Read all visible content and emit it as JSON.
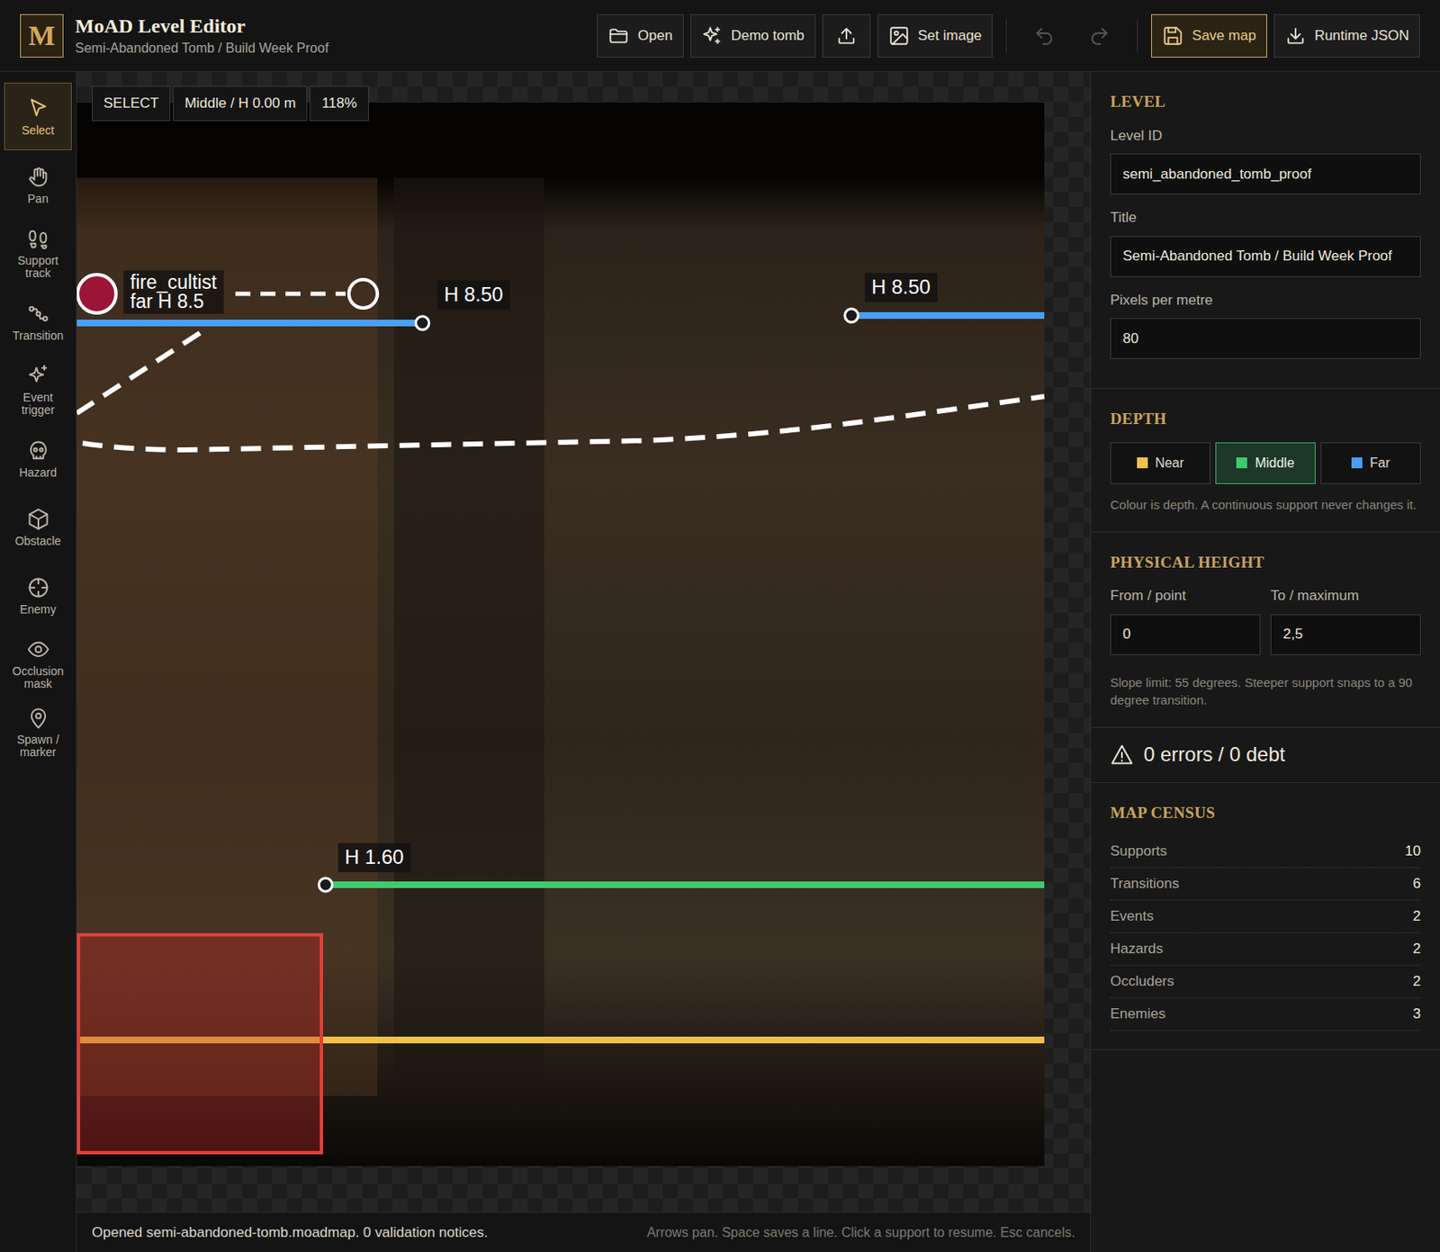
{
  "header": {
    "logo": "M",
    "title": "MoAD Level Editor",
    "subtitle": "Semi-Abandoned Tomb / Build Week Proof"
  },
  "toolbar": [
    {
      "label": "Open",
      "kind": "button",
      "disabled": false
    },
    {
      "label": "Demo tomb",
      "kind": "button",
      "disabled": false
    },
    {
      "kind": "icon",
      "disabled": false
    },
    {
      "label": "Set image",
      "kind": "button",
      "disabled": false
    },
    {
      "kind": "icon",
      "disabled": true
    },
    {
      "kind": "icon",
      "disabled": true
    },
    {
      "label": "Save map",
      "kind": "primary",
      "disabled": false
    },
    {
      "label": "Runtime JSON",
      "kind": "button",
      "disabled": false
    }
  ],
  "tools": [
    {
      "label": "Select",
      "selected": true
    },
    {
      "label": "Pan",
      "selected": false
    },
    {
      "label": "Support track",
      "selected": false
    },
    {
      "label": "Transition",
      "selected": false
    },
    {
      "label": "Event trigger",
      "selected": false
    },
    {
      "label": "Hazard",
      "selected": false
    },
    {
      "label": "Obstacle",
      "selected": false
    },
    {
      "label": "Enemy",
      "selected": false
    },
    {
      "label": "Occlusion mask",
      "selected": false
    },
    {
      "label": "Spawn / marker",
      "selected": false
    }
  ],
  "canvas": {
    "chips": [
      "SELECT",
      "Middle / H 0.00 m",
      "118%"
    ],
    "supports": [
      {
        "label": "H 8.50",
        "color": "#4a9ff5"
      },
      {
        "label": "H 8.50",
        "color": "#4a9ff5"
      },
      {
        "label": "H 1.60",
        "color": "#3dcc6e"
      },
      {
        "color": "#f2c14a"
      }
    ],
    "enemy": {
      "name": "fire_cultist",
      "detail": "far H 8.5"
    }
  },
  "panel": {
    "level": {
      "heading": "LEVEL",
      "fields": [
        {
          "label": "Level ID",
          "value": "semi_abandoned_tomb_proof"
        },
        {
          "label": "Title",
          "value": "Semi-Abandoned Tomb / Build Week Proof"
        },
        {
          "label": "Pixels per metre",
          "value": "80"
        }
      ]
    },
    "depth": {
      "heading": "DEPTH",
      "options": [
        {
          "label": "Near",
          "color": "#f2c14a",
          "selected": false
        },
        {
          "label": "Middle",
          "color": "#3dcc6e",
          "selected": true
        },
        {
          "label": "Far",
          "color": "#4a9ff5",
          "selected": false
        }
      ],
      "note": "Colour is depth. A continuous support never changes it."
    },
    "height": {
      "heading": "PHYSICAL HEIGHT",
      "fields": [
        {
          "label": "From / point",
          "value": "0"
        },
        {
          "label": "To / maximum",
          "value": "2,5"
        }
      ],
      "note": "Slope limit: 55 degrees. Steeper support snaps to a 90 degree transition."
    },
    "validation": {
      "summary": "0 errors / 0 debt"
    },
    "census": {
      "heading": "MAP CENSUS",
      "rows": [
        {
          "label": "Supports",
          "value": "10"
        },
        {
          "label": "Transitions",
          "value": "6"
        },
        {
          "label": "Events",
          "value": "2"
        },
        {
          "label": "Hazards",
          "value": "2"
        },
        {
          "label": "Occluders",
          "value": "2"
        },
        {
          "label": "Enemies",
          "value": "3"
        }
      ]
    }
  },
  "status": {
    "message": "Opened semi-abandoned-tomb.moadmap. 0 validation notices.",
    "hint": "Arrows pan. Space saves a line. Click a support to resume. Esc cancels."
  }
}
